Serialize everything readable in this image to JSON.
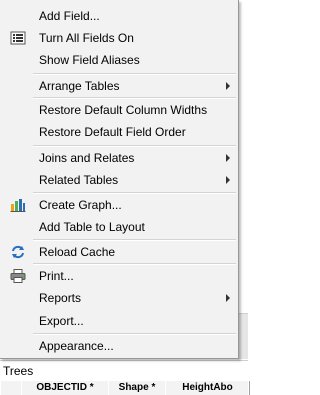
{
  "menu": {
    "items": {
      "add_field": "Add Field...",
      "turn_all_fields_on": "Turn All Fields On",
      "show_field_aliases": "Show Field Aliases",
      "arrange_tables": "Arrange Tables",
      "restore_default_column_widths": "Restore Default Column Widths",
      "restore_default_field_order": "Restore Default Field Order",
      "joins_and_relates": "Joins and Relates",
      "related_tables": "Related Tables",
      "create_graph": "Create Graph...",
      "add_table_to_layout": "Add Table to Layout",
      "reload_cache": "Reload Cache",
      "print": "Print...",
      "reports": "Reports",
      "export": "Export...",
      "appearance": "Appearance..."
    },
    "icons": {
      "turn_all_fields_on": "field-list-icon",
      "create_graph": "bar-chart-icon",
      "reload_cache": "refresh-icon",
      "print": "printer-icon"
    }
  },
  "table_window": {
    "title": "Trees",
    "columns": [
      "OBJECTID *",
      "Shape *",
      "HeightAbo"
    ]
  },
  "colors": {
    "menu_background": "#f2f2f2",
    "separator": "#d4d4d4",
    "chart_blue": "#2e6db4",
    "chart_green": "#4caf50",
    "chart_orange": "#f0a020"
  }
}
